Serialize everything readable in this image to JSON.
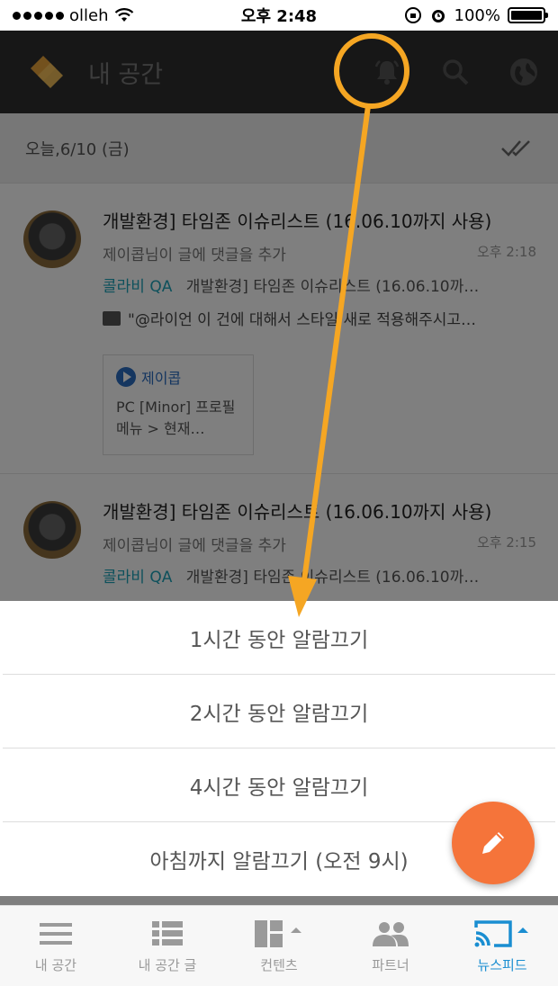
{
  "status_bar": {
    "carrier": "olleh",
    "time": "오후 2:48",
    "battery": "100%"
  },
  "header": {
    "title": "내 공간",
    "icons": [
      "bell-icon",
      "search-icon",
      "globe-icon"
    ]
  },
  "feed": {
    "date": "오늘,6/10 (금)",
    "items": [
      {
        "title": "개발환경] 타임존 이슈리스트 (16.06.10까지 사용)",
        "subtitle": "제이콥님이 글에 댓글을 추가",
        "time": "오후 2:18",
        "space": "콜라비 QA",
        "space_text": "개발환경] 타임존 이슈리스트 (16.06.10까…",
        "comment": "\"@라이언 이 건에 대해서 스타일 새로 적용해주시고…",
        "card_author": "제이콥",
        "card_text": "PC [Minor] 프로필메뉴 > 현재…"
      },
      {
        "title": "개발환경] 타임존 이슈리스트 (16.06.10까지 사용)",
        "subtitle": "제이콥님이 글에 댓글을 추가",
        "time": "오후 2:15",
        "space": "콜라비 QA",
        "space_text": "개발환경] 타임존 이슈리스트 (16.06.10까…"
      }
    ]
  },
  "action_sheet": {
    "options": [
      "1시간 동안 알람끄기",
      "2시간 동안 알람끄기",
      "4시간 동안 알람끄기",
      "아침까지 알람끄기 (오전 9시)"
    ]
  },
  "tabs": [
    {
      "label": "내 공간",
      "icon": "menu-icon"
    },
    {
      "label": "내 공간 글",
      "icon": "list-icon"
    },
    {
      "label": "컨텐츠",
      "icon": "dashboard-icon"
    },
    {
      "label": "파트너",
      "icon": "people-icon"
    },
    {
      "label": "뉴스피드",
      "icon": "cast-icon",
      "active": true
    }
  ],
  "colors": {
    "accent": "#f5a623",
    "fab": "#f5743a",
    "active_tab": "#1a8ed1",
    "space_tag": "#1ca3b8"
  }
}
